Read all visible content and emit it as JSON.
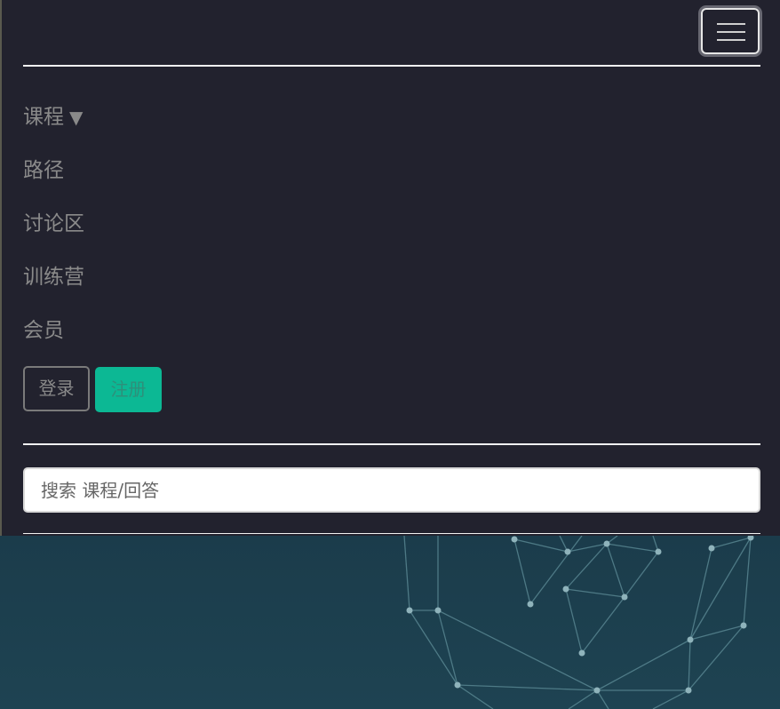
{
  "navbar": {
    "toggle_icon": "hamburger-menu-icon",
    "items": [
      {
        "label": "课程",
        "caret": "▼"
      },
      {
        "label": "路径"
      },
      {
        "label": "讨论区"
      },
      {
        "label": "训练营"
      },
      {
        "label": "会员"
      }
    ],
    "login_label": "登录",
    "register_label": "注册"
  },
  "search": {
    "placeholder": "搜索 课程/回答",
    "value": ""
  },
  "colors": {
    "nav_background": "#22222e",
    "accent_green": "#0cb894",
    "hero_background": "#1c4050"
  }
}
